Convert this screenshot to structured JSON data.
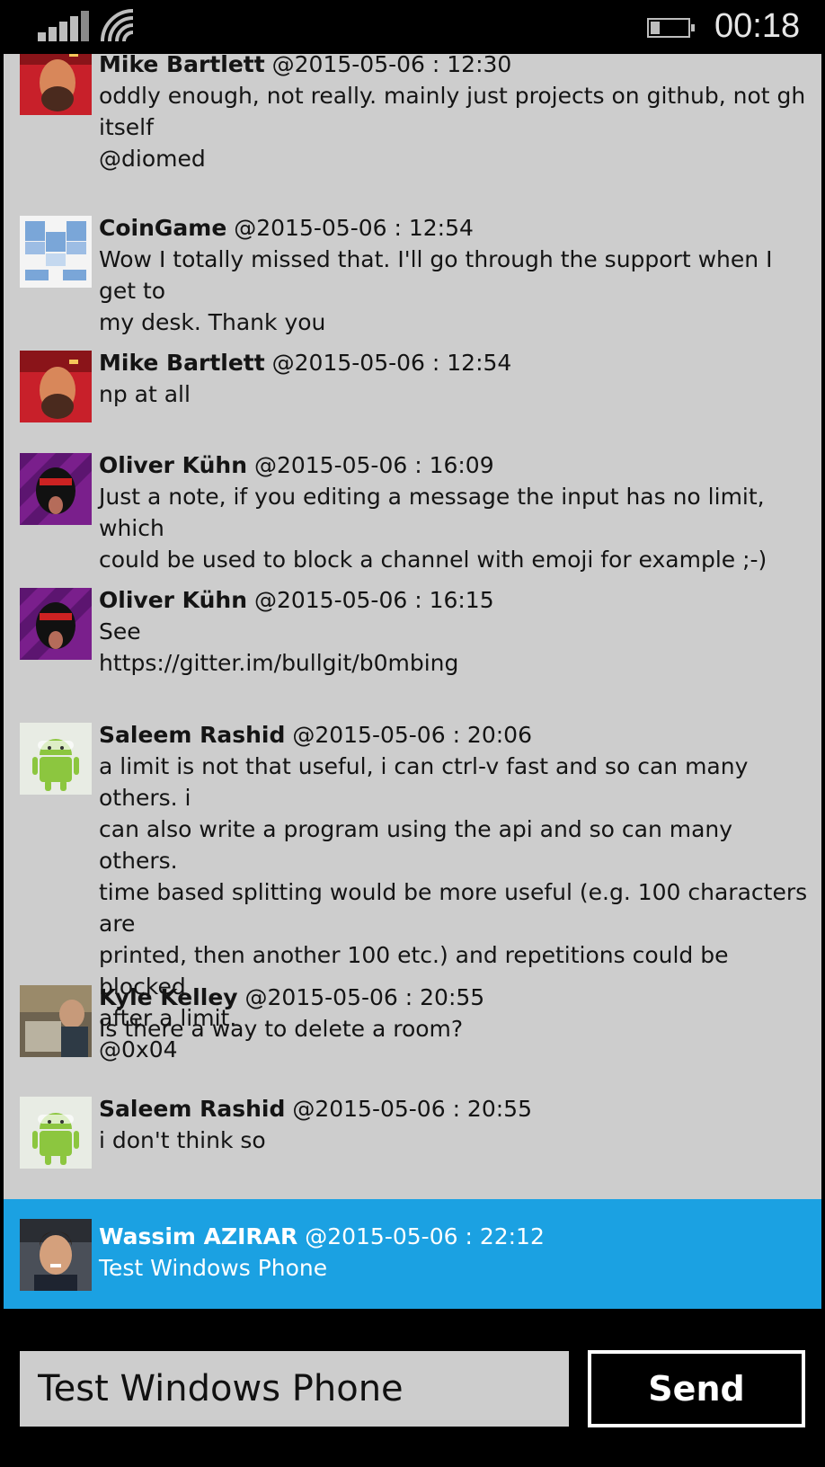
{
  "status_bar": {
    "time": "00:18"
  },
  "messages": [
    {
      "name": "Mike Bartlett",
      "date": "@2015-05-06 : 12:30",
      "body": "oddly enough, not really. mainly just projects on github, not gh\nitself\n@diomed",
      "avatar": "mike-bartlett-avatar"
    },
    {
      "name": "CoinGame",
      "date": "@2015-05-06 : 12:54",
      "body": "Wow I totally missed that. I'll go through the support when I get to\nmy desk. Thank you",
      "avatar": "coingame-avatar"
    },
    {
      "name": "Mike Bartlett",
      "date": "@2015-05-06 : 12:54",
      "body": "np at all",
      "avatar": "mike-bartlett-avatar"
    },
    {
      "name": "Oliver Kühn",
      "date": "@2015-05-06 : 16:09",
      "body": "Just a note, if you editing a message the input has no limit, which\ncould be used to block a channel with emoji for example ;-)",
      "avatar": "oliver-kuhn-avatar"
    },
    {
      "name": "Oliver Kühn",
      "date": "@2015-05-06 : 16:15",
      "body": "See\nhttps://gitter.im/bullgit/b0mbing",
      "avatar": "oliver-kuhn-avatar"
    },
    {
      "name": "Saleem Rashid",
      "date": "@2015-05-06 : 20:06",
      "body": "a limit is not that useful, i can ctrl-v fast and so can many others. i\ncan also write a program using the api and so can many others.\ntime based splitting would be more useful (e.g. 100 characters are\nprinted, then another 100 etc.) and repetitions could be blocked\nafter a limit.\n@0x04",
      "avatar": "android-avatar"
    },
    {
      "name": "Kyle Kelley",
      "date": "@2015-05-06 : 20:55",
      "body": "Is there a way to delete a room?",
      "avatar": "kyle-kelley-avatar"
    },
    {
      "name": "Saleem Rashid",
      "date": "@2015-05-06 : 20:55",
      "body": "i don't think so",
      "avatar": "android-avatar"
    },
    {
      "name": "Wassim AZIRAR",
      "date": "@2015-05-06 : 22:12",
      "body": "Test Windows Phone",
      "avatar": "wassim-azirar-avatar",
      "selected": true
    }
  ],
  "composer": {
    "value": "Test Windows Phone",
    "send_label": "Send"
  },
  "colors": {
    "list_bg": "#cdcdcd",
    "selected_bg": "#1ba1e2",
    "frame_bg": "#000000"
  }
}
